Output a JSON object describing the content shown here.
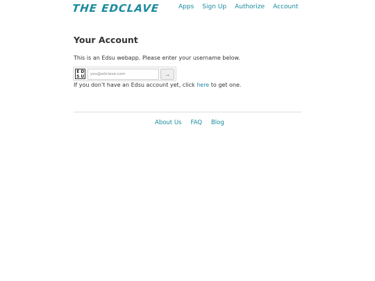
{
  "header": {
    "logo_text": "THE EDCLAVE",
    "nav": [
      {
        "label": "Apps"
      },
      {
        "label": "Sign Up"
      },
      {
        "label": "Authorize"
      },
      {
        "label": "Account"
      }
    ]
  },
  "main": {
    "title": "Your Account",
    "intro": "This is an Edsu webapp. Please enter your username below.",
    "badge_letters": [
      "E",
      "D",
      "S",
      "U"
    ],
    "username": {
      "value": "",
      "placeholder": "you@edclave.com"
    },
    "submit_label": "→",
    "signup_before": "If you don't have an Edsu account yet, click ",
    "signup_link": "here",
    "signup_after": " to get one."
  },
  "footer": {
    "links": [
      {
        "label": "About Us"
      },
      {
        "label": "FAQ"
      },
      {
        "label": "Blog"
      }
    ]
  },
  "colors": {
    "accent": "#1a8a9e",
    "text": "#333333",
    "divider": "#dddddd"
  }
}
